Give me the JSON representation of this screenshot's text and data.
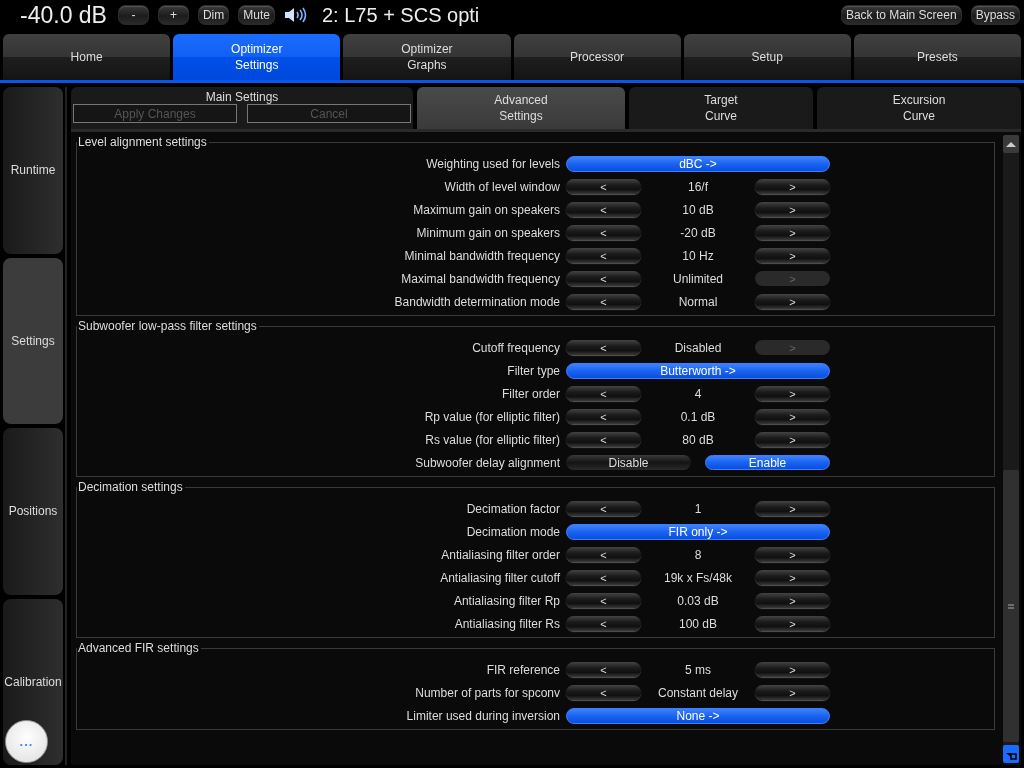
{
  "top_bar": {
    "volume": "-40.0 dB",
    "buttons": [
      {
        "label": "-"
      },
      {
        "label": "+"
      },
      {
        "label": "Dim"
      },
      {
        "label": "Mute"
      }
    ],
    "preset_title": "2: L75 + SCS opti",
    "right_buttons": [
      {
        "label": "Back to Main Screen"
      },
      {
        "label": "Bypass"
      }
    ]
  },
  "main_tabs": [
    {
      "label": "Home",
      "selected": false
    },
    {
      "label": "Optimizer\nSettings",
      "selected": true
    },
    {
      "label": "Optimizer\nGraphs",
      "selected": false
    },
    {
      "label": "Processor",
      "selected": false
    },
    {
      "label": "Setup",
      "selected": false
    },
    {
      "label": "Presets",
      "selected": false
    }
  ],
  "sidebar": {
    "items": [
      {
        "label": "Runtime",
        "selected": false
      },
      {
        "label": "Settings",
        "selected": true
      },
      {
        "label": "Positions",
        "selected": false
      },
      {
        "label": "Calibration",
        "selected": false
      }
    ],
    "more_button": "..."
  },
  "sub_tabs": [
    {
      "label": "Main Settings",
      "selected": false,
      "buttons": [
        {
          "label": "Apply Changes",
          "disabled": true
        },
        {
          "label": "Cancel",
          "disabled": true
        }
      ]
    },
    {
      "label": "Advanced\nSettings",
      "selected": true
    },
    {
      "label": "Target\nCurve",
      "selected": false
    },
    {
      "label": "Excursion\nCurve",
      "selected": false
    }
  ],
  "groups": [
    {
      "title": "Level alignment settings",
      "rows": [
        {
          "label": "Weighting used for levels",
          "kind": "choice",
          "value": "dBC ->"
        },
        {
          "label": "Width of level window",
          "kind": "stepper",
          "prev": {
            "label": "<",
            "disabled": false
          },
          "value": "16/f",
          "next": {
            "label": ">",
            "disabled": false
          }
        },
        {
          "label": "Maximum gain on speakers",
          "kind": "stepper",
          "prev": {
            "label": "<",
            "disabled": false
          },
          "value": "10 dB",
          "next": {
            "label": ">",
            "disabled": false
          }
        },
        {
          "label": "Minimum gain on speakers",
          "kind": "stepper",
          "prev": {
            "label": "<",
            "disabled": false
          },
          "value": "-20 dB",
          "next": {
            "label": ">",
            "disabled": false
          }
        },
        {
          "label": "Minimal bandwidth frequency",
          "kind": "stepper",
          "prev": {
            "label": "<",
            "disabled": false
          },
          "value": "10 Hz",
          "next": {
            "label": ">",
            "disabled": false
          }
        },
        {
          "label": "Maximal bandwidth frequency",
          "kind": "stepper",
          "prev": {
            "label": "<",
            "disabled": false
          },
          "value": "Unlimited",
          "next": {
            "label": ">",
            "disabled": true
          }
        },
        {
          "label": "Bandwidth determination mode",
          "kind": "stepper",
          "prev": {
            "label": "<",
            "disabled": false
          },
          "value": "Normal",
          "next": {
            "label": ">",
            "disabled": false
          }
        }
      ]
    },
    {
      "title": "Subwoofer low-pass filter settings",
      "rows": [
        {
          "label": "Cutoff frequency",
          "kind": "stepper",
          "prev": {
            "label": "<",
            "disabled": false
          },
          "value": "Disabled",
          "next": {
            "label": ">",
            "disabled": true
          }
        },
        {
          "label": "Filter type",
          "kind": "choice",
          "value": "Butterworth ->"
        },
        {
          "label": "Filter order",
          "kind": "stepper",
          "prev": {
            "label": "<",
            "disabled": false
          },
          "value": "4",
          "next": {
            "label": ">",
            "disabled": false
          }
        },
        {
          "label": "Rp value (for elliptic filter)",
          "kind": "stepper",
          "prev": {
            "label": "<",
            "disabled": false
          },
          "value": "0.1 dB",
          "next": {
            "label": ">",
            "disabled": false
          }
        },
        {
          "label": "Rs value (for elliptic filter)",
          "kind": "stepper",
          "prev": {
            "label": "<",
            "disabled": false
          },
          "value": "80 dB",
          "next": {
            "label": ">",
            "disabled": false
          }
        },
        {
          "label": "Subwoofer delay alignment",
          "kind": "toggle",
          "options": [
            {
              "label": "Disable",
              "selected": false
            },
            {
              "label": "Enable",
              "selected": true
            }
          ]
        }
      ]
    },
    {
      "title": "Decimation settings",
      "rows": [
        {
          "label": "Decimation factor",
          "kind": "stepper",
          "prev": {
            "label": "<",
            "disabled": false
          },
          "value": "1",
          "next": {
            "label": ">",
            "disabled": false
          }
        },
        {
          "label": "Decimation mode",
          "kind": "choice",
          "value": "FIR only ->"
        },
        {
          "label": "Antialiasing filter order",
          "kind": "stepper",
          "prev": {
            "label": "<",
            "disabled": false
          },
          "value": "8",
          "next": {
            "label": ">",
            "disabled": false
          }
        },
        {
          "label": "Antialiasing filter cutoff",
          "kind": "stepper",
          "prev": {
            "label": "<",
            "disabled": false
          },
          "value": "19k x Fs/48k",
          "next": {
            "label": ">",
            "disabled": false
          }
        },
        {
          "label": "Antialiasing filter Rp",
          "kind": "stepper",
          "prev": {
            "label": "<",
            "disabled": false
          },
          "value": "0.03 dB",
          "next": {
            "label": ">",
            "disabled": false
          }
        },
        {
          "label": "Antialiasing filter Rs",
          "kind": "stepper",
          "prev": {
            "label": "<",
            "disabled": false
          },
          "value": "100 dB",
          "next": {
            "label": ">",
            "disabled": false
          }
        }
      ]
    },
    {
      "title": "Advanced FIR settings",
      "rows": [
        {
          "label": "FIR reference",
          "kind": "stepper",
          "prev": {
            "label": "<",
            "disabled": false
          },
          "value": "5 ms",
          "next": {
            "label": ">",
            "disabled": false
          }
        },
        {
          "label": "Number of parts for spconv",
          "kind": "stepper",
          "prev": {
            "label": "<",
            "disabled": false
          },
          "value": "Constant delay",
          "next": {
            "label": ">",
            "disabled": false
          }
        },
        {
          "label": "Limiter used during inversion",
          "kind": "choice",
          "value": "None ->"
        }
      ]
    }
  ]
}
